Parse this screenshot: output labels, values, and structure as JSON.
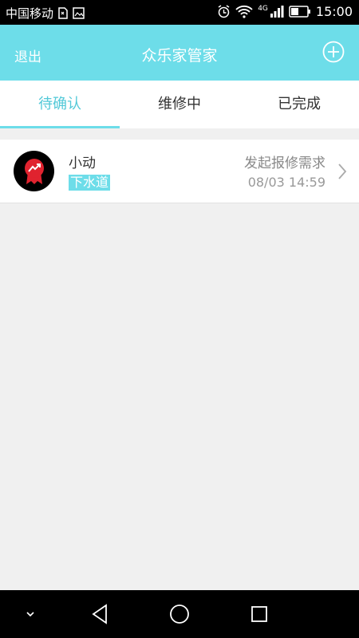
{
  "status_bar": {
    "carrier": "中国移动",
    "network": "4G",
    "time": "15:00"
  },
  "header": {
    "exit_label": "退出",
    "title": "众乐家管家",
    "add_icon": "plus-circle-icon"
  },
  "tabs": [
    {
      "label": "待确认",
      "active": true
    },
    {
      "label": "维修中",
      "active": false
    },
    {
      "label": "已完成",
      "active": false
    }
  ],
  "items": [
    {
      "name": "小动",
      "tag": "下水道",
      "status": "发起报修需求",
      "time": "08/03 14:59",
      "avatar_icon": "badge-chart-icon"
    }
  ],
  "colors": {
    "accent": "#6ddde9",
    "active_tab_text": "#53c9d8",
    "background": "#f0f0f0"
  },
  "nav_icons": [
    "chevron-down-icon",
    "back-icon",
    "home-icon",
    "recents-icon"
  ]
}
